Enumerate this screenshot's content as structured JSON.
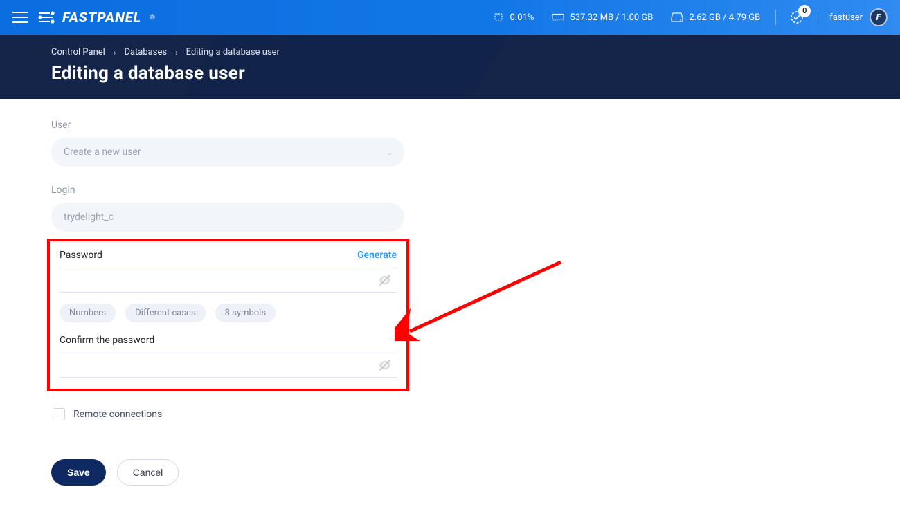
{
  "header": {
    "brand": "FASTPANEL",
    "brand_mark": "®",
    "stats": {
      "cpu": "0.01%",
      "ram": "537.32 MB / 1.00 GB",
      "disk": "2.62 GB / 4.79 GB"
    },
    "notifications_count": "0",
    "username": "fastuser",
    "avatar_letter": "F"
  },
  "breadcrumb": {
    "items": [
      "Control Panel",
      "Databases",
      "Editing a database user"
    ]
  },
  "page": {
    "title": "Editing a database user"
  },
  "form": {
    "user_label": "User",
    "user_placeholder": "Create a new user",
    "login_label": "Login",
    "login_value": "trydelight_c",
    "password_label": "Password",
    "generate_label": "Generate",
    "chips": [
      "Numbers",
      "Different cases",
      "8 symbols"
    ],
    "confirm_label": "Confirm the password",
    "remote_label": "Remote connections",
    "save_label": "Save",
    "cancel_label": "Cancel"
  }
}
